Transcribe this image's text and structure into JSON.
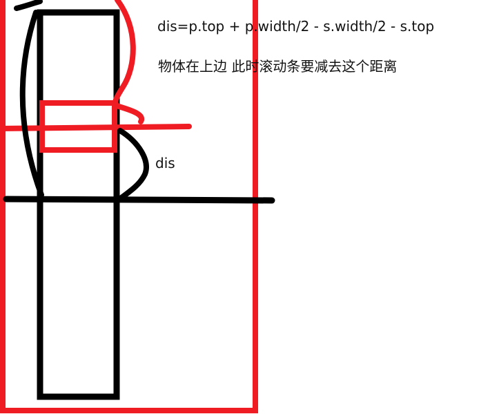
{
  "annotations": {
    "formula": "dis=p.top + p.width/2 - s.width/2 - s.top",
    "note": "物体在上边 此时滚动条要减去这个距离",
    "dis_label": "dis"
  },
  "colors": {
    "red": "#ef1c24",
    "black": "#000000",
    "background": "#ffffff"
  }
}
